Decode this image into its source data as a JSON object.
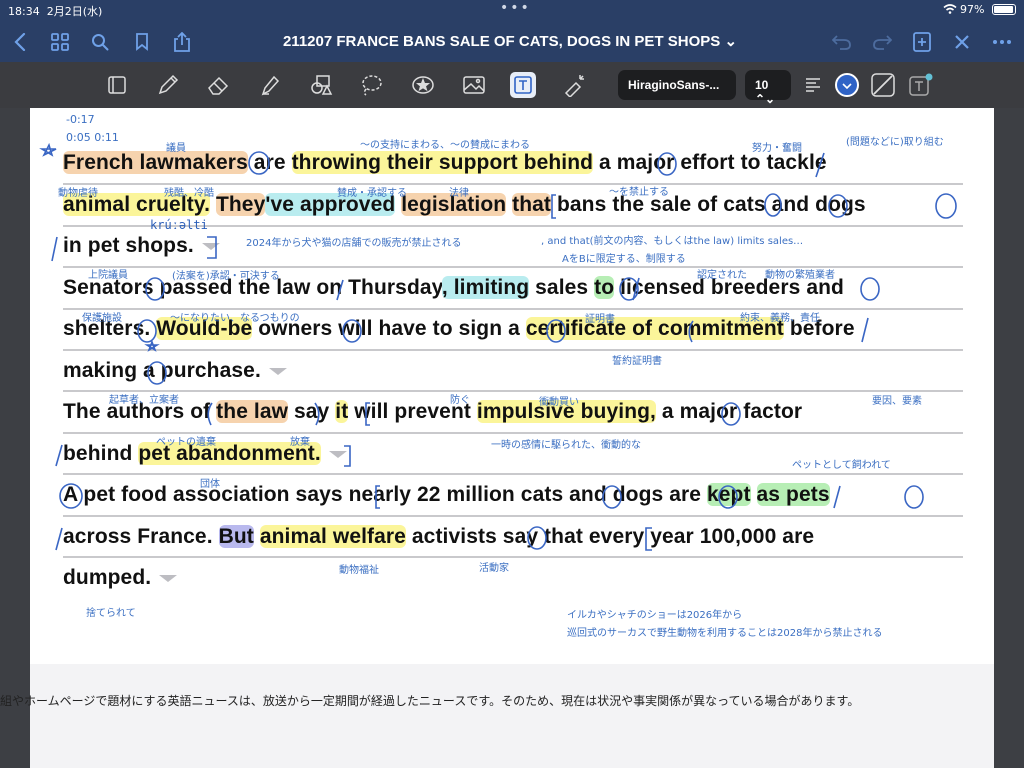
{
  "status": {
    "time": "18:34",
    "date": "2月2日(水)",
    "battery": "97%",
    "battery_level": 0.97
  },
  "nav": {
    "title": "211207 FRANCE BANS SALE OF CATS, DOGS IN PET SHOPS ⌄"
  },
  "toolbar": {
    "font": "HiraginoSans-...",
    "size": "10 ⌃⌄"
  },
  "timecode": {
    "t1": "-0:17",
    "t2": "0:05 0:11"
  },
  "article": {
    "l1": {
      "a": "French lawmakers",
      "b": " are ",
      "c": "throwing their support behind",
      "d": " a major effort ",
      "e": "to tackle"
    },
    "l2": {
      "a": "animal cruelty.",
      "b": " ",
      "c": "They",
      "d": "'ve approved",
      "e": " ",
      "f": "legislation",
      "g": " ",
      "h": "that",
      "i": " bans the sale of cats and dogs"
    },
    "l3": {
      "a": "in pet shops."
    },
    "l4": {
      "a": "Senators passed the law on Thursday",
      "b": ", limiting",
      "c": " sales ",
      "d": "to",
      "e": " licensed breeders and"
    },
    "l5": {
      "a": "shelters. ",
      "b": "Would-be",
      "c": " owners will have to sign a ",
      "d": "certificate of commitment",
      "e": " before"
    },
    "l6": {
      "a": "making a purchase."
    },
    "l7": {
      "a": "The authors of ",
      "b": "the law",
      "c": " say ",
      "d": "it",
      "e": " will prevent ",
      "f": "impulsive buying,",
      "g": " a major factor"
    },
    "l8": {
      "a": "behind ",
      "b": "pet abandonment."
    },
    "l9": {
      "a": "A pet food association says nearly 22 million cats and dogs are ",
      "b": "kept",
      "c": " ",
      "d": "as pets"
    },
    "l10": {
      "a": "across France. ",
      "b": "But",
      "c": " ",
      "d": "animal welfare",
      "e": " activists say that every year 100,000 are"
    },
    "l11": {
      "a": "dumped."
    }
  },
  "notes": {
    "n1": "議員",
    "n2": "〜の支持にまわる、〜の賛成にまわる",
    "n3": "努力・奮闘",
    "n4": "(問題などに)取り組む",
    "n5": "動物虐待",
    "n6": "残酷、冷酷",
    "n7": "賛成・承認する",
    "n8": "法律",
    "n9": "〜を禁止する",
    "n10": "krúːəlti",
    "n11": "2024年から犬や猫の店舗での販売が禁止される",
    "n12": ", and that(前文の内容、もしくはthe law) limits sales…",
    "n13": "AをBに限定する、制限する",
    "n14": "上院議員",
    "n15": "(法案を)承認・可決する",
    "n16": "認定された",
    "n17": "動物の繁殖業者",
    "n18": "保護施設",
    "n19": "〜になりたい、なるつもりの",
    "n20": "証明書",
    "n21": "約束、義務、責任",
    "n22": "誓約証明書",
    "n23": "起草者、立案者",
    "n24": "防ぐ",
    "n25": "衝動買い",
    "n26": "要因、要素",
    "n27": "ペットの遺棄",
    "n28": "放棄",
    "n29": "一時の感情に駆られた、衝動的な",
    "n30": "ペットとして飼われて",
    "n31": "団体",
    "n32": "動物福祉",
    "n33": "活動家",
    "n34": "捨てられて",
    "n35": "イルカやシャチのショーは2026年から",
    "n36": "巡回式のサーカスで野生動物を利用することは2028年から禁止される"
  },
  "footer": "組やホームページで題材にする英語ニュースは、放送から一定期間が経過したニュースです。そのため、現在は状況や事実関係が異なっている場合があります。"
}
